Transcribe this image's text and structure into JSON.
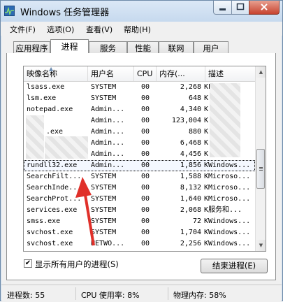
{
  "window": {
    "title": "Windows 任务管理器"
  },
  "menu": [
    "文件(F)",
    "选项(O)",
    "查看(V)",
    "帮助(H)"
  ],
  "tabs": [
    "应用程序",
    "进程",
    "服务",
    "性能",
    "联网",
    "用户"
  ],
  "active_tab": "进程",
  "columns": [
    "映像名称",
    "用户名",
    "CPU",
    "内存(...",
    "描述"
  ],
  "processes": [
    {
      "name": "lsass.exe",
      "user": "SYSTEM",
      "cpu": "00",
      "mem": "2,268",
      "unit": "K",
      "desc": "L..."
    },
    {
      "name": "lsm.exe",
      "user": "SYSTEM",
      "cpu": "00",
      "mem": "648",
      "unit": "K",
      "desc": ""
    },
    {
      "name": "notepad.exe",
      "user": "Admin...",
      "cpu": "00",
      "mem": "4,340",
      "unit": "K",
      "desc": ""
    },
    {
      "name": "",
      "user": "Admin...",
      "cpu": "00",
      "mem": "123,004",
      "unit": "K",
      "desc": ""
    },
    {
      "name": ".exe",
      "user": "Admin...",
      "cpu": "00",
      "mem": "880",
      "unit": "K",
      "desc": ""
    },
    {
      "name": "",
      "user": "Admin...",
      "cpu": "00",
      "mem": "6,468",
      "unit": "K",
      "desc": ""
    },
    {
      "name": "",
      "user": "Admin...",
      "cpu": "00",
      "mem": "4,456",
      "unit": "K",
      "desc": ""
    },
    {
      "name": "rundll32.exe",
      "user": "Admin...",
      "cpu": "00",
      "mem": "1,856",
      "unit": "K",
      "desc": "Windows..."
    },
    {
      "name": "SearchFilt...",
      "user": "SYSTEM",
      "cpu": "00",
      "mem": "1,588",
      "unit": "K",
      "desc": "Microso..."
    },
    {
      "name": "SearchInde...",
      "user": "SYSTEM",
      "cpu": "00",
      "mem": "8,132",
      "unit": "K",
      "desc": "Microso..."
    },
    {
      "name": "SearchProt...",
      "user": "SYSTEM",
      "cpu": "00",
      "mem": "1,640",
      "unit": "K",
      "desc": "Microso..."
    },
    {
      "name": "services.exe",
      "user": "SYSTEM",
      "cpu": "00",
      "mem": "2,068",
      "unit": "K",
      "desc": "服务和..."
    },
    {
      "name": "smss.exe",
      "user": "SYSTEM",
      "cpu": "00",
      "mem": "72",
      "unit": "K",
      "desc": "Windows..."
    },
    {
      "name": "svchost.exe",
      "user": "SYSTEM",
      "cpu": "00",
      "mem": "1,704",
      "unit": "K",
      "desc": "Windows..."
    },
    {
      "name": "svchost.exe",
      "user": "NETWO...",
      "cpu": "00",
      "mem": "2,256",
      "unit": "K",
      "desc": "Windows..."
    }
  ],
  "selected_index": 7,
  "show_all_users": {
    "label": "显示所有用户的进程",
    "hotkey": "(S)",
    "checked": "✔"
  },
  "end_process_label": "结束进程(E)",
  "status": {
    "processes": "进程数: 55",
    "cpu": "CPU 使用率: 8%",
    "memory": "物理内存: 58%"
  },
  "accent_arrow_color": "#e0302a"
}
